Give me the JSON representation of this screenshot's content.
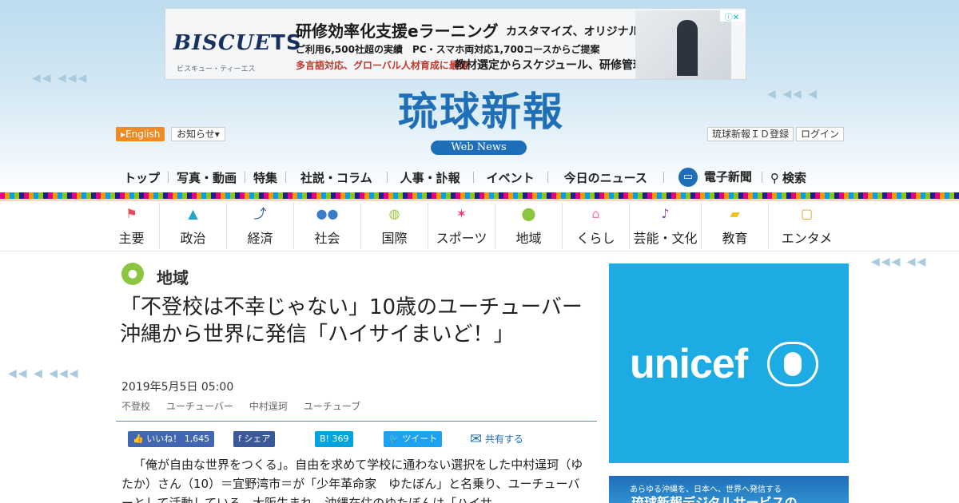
{
  "ad": {
    "logo": "BISCUE",
    "logo_ts": "TS",
    "logo_sub": "ビスキュー・ティーエス",
    "headline": "研修効率化支援eラーニング",
    "headline_side": "カスタマイズ、オリジナルコース作成",
    "line2": "ご利用6,500社超の実績　PC・スマホ両対応1,700コースからご提案",
    "line3_red": "多言語対応、グローバル人材育成に最適",
    "line3_black": "教材選定からスケジュール、研修管理までサポート",
    "close_label": "ⓘ✕"
  },
  "header": {
    "logo": "琉球新報",
    "webnews": "Web News",
    "english": "▸English",
    "notice": "お知らせ▾",
    "register": "琉球新報ＩＤ登録",
    "login": "ログイン"
  },
  "topnav": {
    "items": [
      "トップ",
      "写真・動画",
      "特集",
      "社説・コラム",
      "人事・訃報",
      "イベント",
      "今日のニュース"
    ],
    "epaper": "電子新聞",
    "search": "検索"
  },
  "categories": [
    {
      "label": "主要",
      "icon": "flag-icon",
      "glyph": "⚑",
      "color": "#e84a5f"
    },
    {
      "label": "政治",
      "icon": "government-icon",
      "glyph": "▲",
      "color": "#26a5c8"
    },
    {
      "label": "経済",
      "icon": "chart-icon",
      "glyph": "⤴",
      "color": "#3056a0"
    },
    {
      "label": "社会",
      "icon": "people-icon",
      "glyph": "●●",
      "color": "#3b7cc9"
    },
    {
      "label": "国際",
      "icon": "globe-icon",
      "glyph": "◍",
      "color": "#9bc53d"
    },
    {
      "label": "スポーツ",
      "icon": "runner-icon",
      "glyph": "✶",
      "color": "#e5397a"
    },
    {
      "label": "地域",
      "icon": "map-pin-icon",
      "glyph": "⬤",
      "color": "#8cc63f"
    },
    {
      "label": "くらし",
      "icon": "home-icon",
      "glyph": "⌂",
      "color": "#f07ea4"
    },
    {
      "label": "芸能・文化",
      "icon": "music-icon",
      "glyph": "♪",
      "color": "#8e44ad"
    },
    {
      "label": "教育",
      "icon": "graduation-icon",
      "glyph": "▰",
      "color": "#f0c419"
    },
    {
      "label": "エンタメ",
      "icon": "tv-icon",
      "glyph": "▢",
      "color": "#f39c12"
    }
  ],
  "article": {
    "region": "地域",
    "headline": "「不登校は不幸じゃない」10歳のユーチューバー　沖縄から世界に発信「ハイサイまいど！」",
    "date": "2019年5月5日 05:00",
    "tags": [
      "不登校",
      "ユーチューバー",
      "中村逞珂",
      "ユーチューブ"
    ],
    "share": {
      "like": "👍 いいね！ 1,645",
      "facebook": "f シェア",
      "hatena": "B! 369",
      "tweet": "🐦 ツイート",
      "mail": "共有する"
    },
    "body": "「俺が自由な世界をつくる」。自由を求めて学校に通わない選択をした中村逞珂（ゆたか）さん（10）＝宜野湾市＝が「少年革命家　ゆたぼん」と名乗り、ユーチューバーとして活動している。大阪生まれ、沖縄在住のゆたぼんは「ハイサ"
  },
  "sidebar": {
    "unicef": "unicef",
    "digital_small": "あらゆる沖縄を、日本へ、世界へ発信する",
    "digital_big": "琉球新報デジタルサービスの"
  },
  "colors": {
    "brand": "#1f6fb8",
    "english_btn": "#f08a24",
    "unicef": "#1cabe2",
    "region_pin": "#8cc63f"
  }
}
